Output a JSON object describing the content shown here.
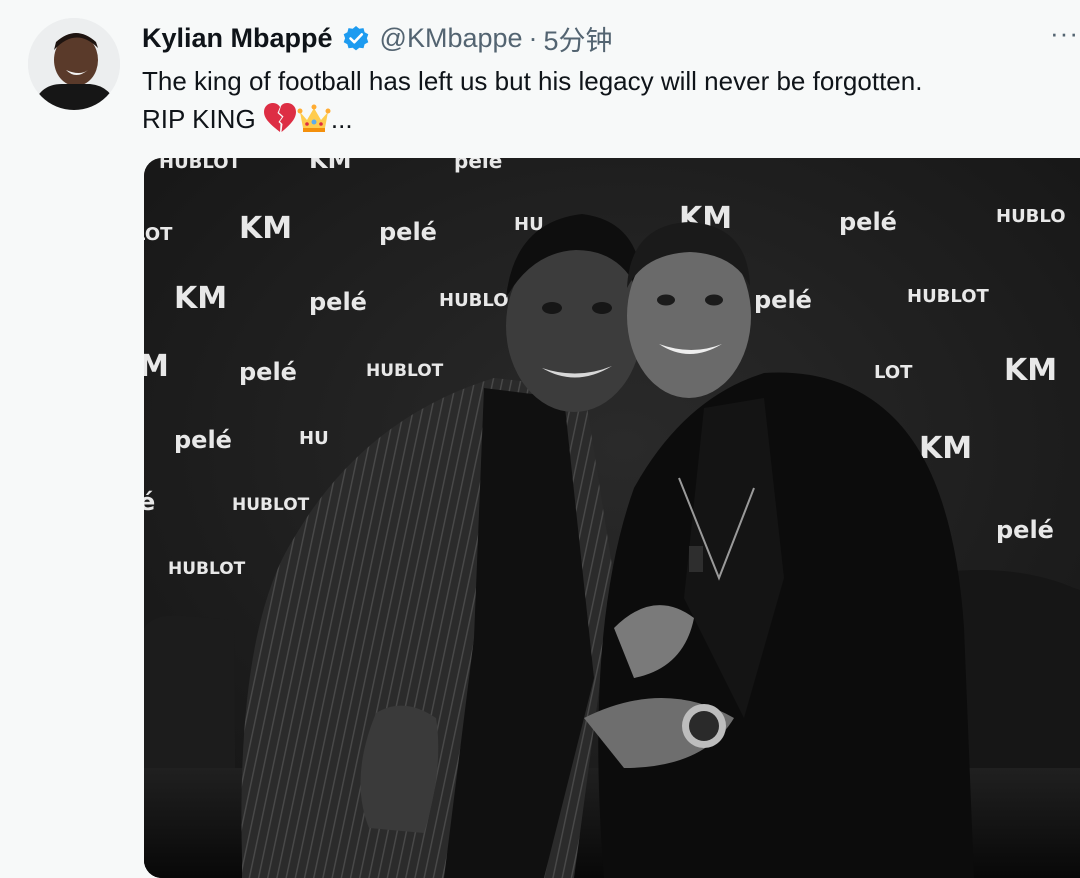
{
  "tweet": {
    "author": {
      "display_name": "Kylian Mbappé",
      "verified": true,
      "handle": "@KMbappe",
      "time": "5分钟",
      "avatar_icon": "profile-photo"
    },
    "text_line1": "The king of football has left us but his legacy will never be forgotten.",
    "text_line2": "RIP KING",
    "text_suffix": "...",
    "emojis": [
      "broken-heart-icon",
      "crown-icon"
    ],
    "more_label": "···",
    "media": {
      "type": "photo",
      "style": "black-and-white",
      "backdrop_logos": [
        "HUBLOT",
        "KM",
        "pelé"
      ]
    }
  },
  "colors": {
    "verified_badge": "#1d9bf0",
    "secondary_text": "#536471",
    "primary_text": "#0f1419",
    "background": "#f7f9f9"
  }
}
